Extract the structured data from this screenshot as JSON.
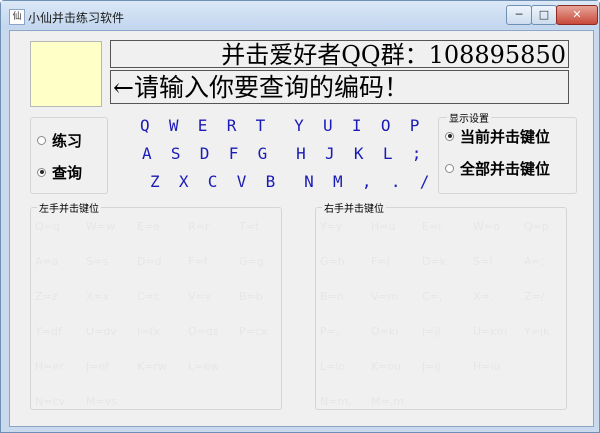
{
  "window": {
    "title": "小仙并击练习软件",
    "app_icon": "app-icon",
    "min_icon": "─",
    "max_icon": "□",
    "close_icon": "✕"
  },
  "banner": "并击爱好者QQ群：108895850",
  "prompt": "←请输入你要查询的编码！",
  "modes": {
    "practice": "练习",
    "query": "查询",
    "selected": "query"
  },
  "keyboard": {
    "row1": "Q  W  E  R  T   Y  U  I  O  P",
    "row2": "A  S  D  F  G   H  J  K  L  ;",
    "row3": "Z  X  C  V  B   N  M  ,  .  /"
  },
  "display": {
    "group_label": "显示设置",
    "current": "当前并击键位",
    "all": "全部并击键位",
    "selected": "current"
  },
  "left_group": {
    "label": "左手并击键位",
    "rows": [
      [
        "Q=q",
        "W=w",
        "E=e",
        "R=r",
        "T=t"
      ],
      [
        "A=a",
        "S=s",
        "D=d",
        "F=f",
        "G=g"
      ],
      [
        "Z=z",
        "X=x",
        "C=c",
        "V=v",
        "B=b"
      ],
      [
        "Y=df",
        "U=dv",
        "I=fx",
        "O=ds",
        "P=cx"
      ],
      [
        "H=er",
        "J=ef",
        "K=rw",
        "L=ew"
      ],
      [
        "N=cv",
        "M=vs"
      ]
    ]
  },
  "right_group": {
    "label": "右手并击键位",
    "rows": [
      [
        "Y=y",
        "H=u",
        "E=i",
        "W=o",
        "Q=p"
      ],
      [
        "G=h",
        "F=j",
        "D=k",
        "S=l",
        "A=;"
      ],
      [
        "B=n",
        "V=m",
        "C=,",
        "X=.",
        "Z=/"
      ],
      [
        "P=,.",
        "O=kl",
        "I=jl",
        "U=km",
        "Y=jk"
      ],
      [
        "L=io",
        "K=ou",
        "J=ij",
        "H=iu"
      ],
      [
        "N=m,",
        "M=,m"
      ]
    ]
  },
  "colors": {
    "keyboard_text": "#1b1bb5",
    "faded_text": "#e6e6e6",
    "yellow_box": "#ffffc8"
  }
}
